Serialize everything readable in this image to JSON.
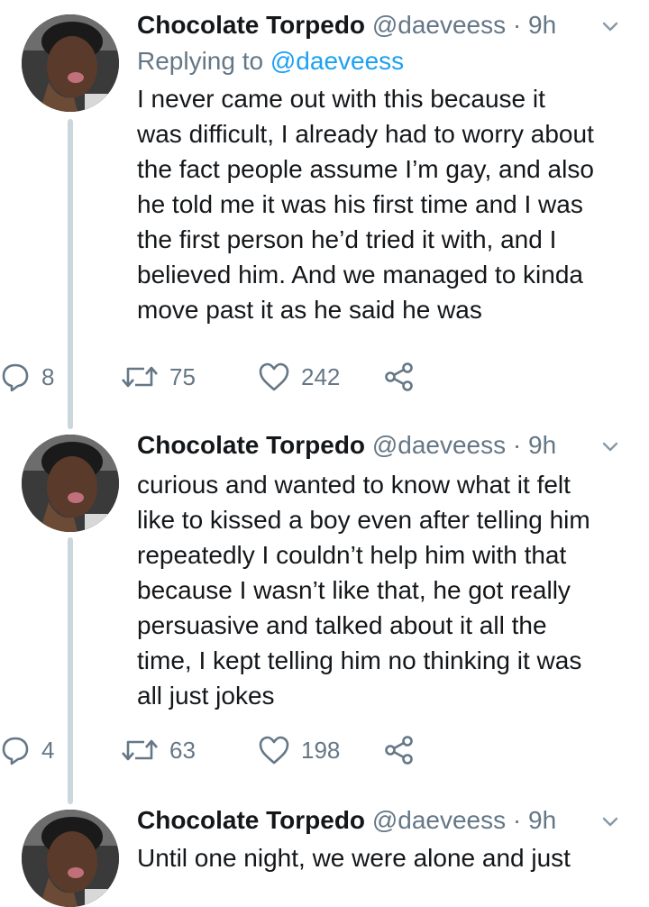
{
  "tweets": [
    {
      "name": "Chocolate Torpedo",
      "handle": "@daeveess",
      "separator": "·",
      "time": "9h",
      "replying_prefix": "Replying to",
      "replying_to": "@daeveess",
      "lines": [
        "I never came out with this because it",
        "was difficult, I already had to worry about",
        "the fact people assume I’m gay, and also",
        "he told me it was his first time and I was",
        "the first person he’d tried it with, and I",
        "believed him. And we managed to kinda",
        "move past it as he said he was"
      ],
      "replies": "8",
      "retweets": "75",
      "likes": "242"
    },
    {
      "name": "Chocolate Torpedo",
      "handle": "@daeveess",
      "separator": "·",
      "time": "9h",
      "lines": [
        "curious and wanted to know what it felt",
        "like to kissed a boy even after telling him",
        "repeatedly I couldn’t help him with that",
        "because I wasn’t like that, he got really",
        "persuasive and talked about it all the",
        "time, I kept telling him no thinking it was",
        "all just jokes"
      ],
      "replies": "4",
      "retweets": "63",
      "likes": "198"
    },
    {
      "name": "Chocolate Torpedo",
      "handle": "@daeveess",
      "separator": "·",
      "time": "9h",
      "lines": [
        "Until one night, we were alone and just"
      ]
    }
  ],
  "icons": {
    "reply": "speech-bubble-icon",
    "retweet": "retweet-arrows-icon",
    "like": "heart-icon",
    "share": "share-nodes-icon",
    "menu": "chevron-down-icon"
  },
  "colors": {
    "name": "#14171a",
    "secondary": "#657786",
    "link": "#1da1f2",
    "thread_line": "#ccd6dd"
  }
}
